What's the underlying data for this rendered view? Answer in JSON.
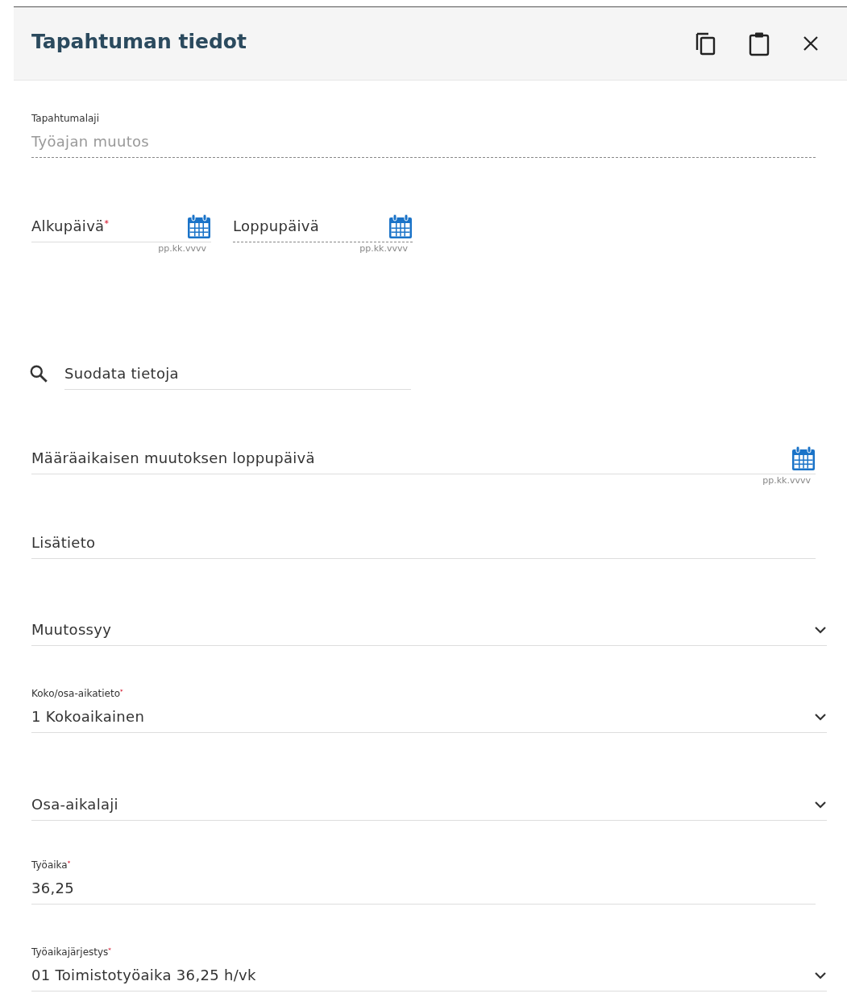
{
  "header": {
    "title": "Tapahtuman tiedot"
  },
  "fields": [
    {
      "kind": "readonly",
      "label": "Tapahtumalaji",
      "value": "Työajan muutos"
    },
    {
      "kind": "date_pair",
      "items": [
        {
          "placeholder": "Alkupäivä$^{*}$",
          "hint": "pp.kk.vvvv",
          "disabled": false
        },
        {
          "placeholder": "Loppupäivä",
          "hint": "pp.kk.vvvv",
          "disabled": true
        }
      ]
    },
    {
      "kind": "search",
      "placeholder": "Suodata tietoja"
    },
    {
      "kind": "date",
      "placeholder": "Määräaikaisen muutoksen loppupäivä",
      "hint": "pp.kk.vvvv"
    },
    {
      "kind": "text",
      "placeholder": "Lisätieto"
    },
    {
      "kind": "select",
      "placeholder": "Muutossyy"
    },
    {
      "kind": "select",
      "label": "Koko/osa-aikatieto$^{*}$",
      "value": "1 Kokoaikainen"
    },
    {
      "kind": "select",
      "placeholder": "Osa-aikalaji"
    },
    {
      "kind": "text",
      "label": "Työaika$^{*}$",
      "value": "36,25"
    },
    {
      "kind": "select",
      "label": "Työaikajärjestys$^{*}$",
      "value": "01 Toimistotyöaika 36,25 h/vk"
    }
  ]
}
